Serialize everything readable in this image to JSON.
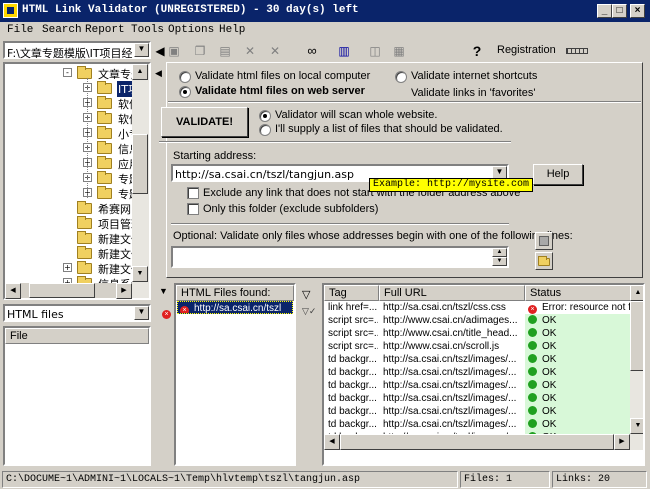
{
  "title": "HTML Link Validator (UNREGISTERED) - 30 day(s) left",
  "menu": [
    "File",
    "Search",
    "Report",
    "Tools",
    "Options",
    "Help"
  ],
  "toolbar": {
    "registration": "Registration",
    "help_icon": "?"
  },
  "path_combo": "F:\\文章专题模版\\IT项目经",
  "tree": [
    {
      "label": "文章专题",
      "pm": "-",
      "indent": 0
    },
    {
      "label": "IT项",
      "pm": "+",
      "indent": 1,
      "selected": true
    },
    {
      "label": "软件",
      "pm": "+",
      "indent": 1
    },
    {
      "label": "软件",
      "pm": "+",
      "indent": 1
    },
    {
      "label": "小专",
      "pm": "+",
      "indent": 1
    },
    {
      "label": "信息",
      "pm": "+",
      "indent": 1
    },
    {
      "label": "应用",
      "pm": "+",
      "indent": 1
    },
    {
      "label": "专题",
      "pm": "+",
      "indent": 1
    },
    {
      "label": "专题",
      "pm": "+",
      "indent": 1
    },
    {
      "label": "希赛网",
      "pm": "",
      "indent": -1
    },
    {
      "label": "项目管理",
      "pm": "",
      "indent": -1
    },
    {
      "label": "新建文件",
      "pm": "",
      "indent": -1
    },
    {
      "label": "新建文件",
      "pm": "",
      "indent": -1
    },
    {
      "label": "新建文件",
      "pm": "+",
      "indent": -1
    },
    {
      "label": "信息系统",
      "pm": "+",
      "indent": -1
    }
  ],
  "filter_combo": "HTML files",
  "file_list_header": "File",
  "options": {
    "radio_local": "Validate html files on local computer",
    "radio_web": "Validate html files on web server",
    "radio_shortcuts": "Validate internet shortcuts",
    "favorites_text": "Validate links in 'favorites'",
    "validate_button": "VALIDATE!",
    "radio_scan": "Validator will scan whole website.",
    "radio_list": "I'll supply a list of files that should be validated.",
    "starting_address_label": "Starting address:",
    "starting_address_value": "http://sa.csai.cn/tszl/tangjun.asp",
    "tooltip": "Example: http://mysite.com",
    "help_button": "Help",
    "chk_exclude": "Exclude any link that does not start with the folder address above",
    "chk_folder": "Only this folder (exclude subfolders)",
    "optional_label": "Optional: Validate only files whose addresses begin with one of the following lines:"
  },
  "html_files": {
    "header": "HTML Files found:",
    "items": [
      "http://sa.csai.cn/tszl"
    ]
  },
  "links_table": {
    "headers": [
      "Tag",
      "Full URL",
      "Status"
    ],
    "rows": [
      {
        "tag": "link href=...",
        "url": "http://sa.csai.cn/tszl/css.css",
        "status": "Error: resource not fo",
        "ok": false
      },
      {
        "tag": "script src=...",
        "url": "http://www.csai.cn/adimages...",
        "status": "OK",
        "ok": true
      },
      {
        "tag": "script src=...",
        "url": "http://www.csai.cn/title_head...",
        "status": "OK",
        "ok": true
      },
      {
        "tag": "script src=...",
        "url": "http://www.csai.cn/scroll.js",
        "status": "OK",
        "ok": true
      },
      {
        "tag": "td backgr...",
        "url": "http://sa.csai.cn/tszl/images/...",
        "status": "OK",
        "ok": true
      },
      {
        "tag": "td backgr...",
        "url": "http://sa.csai.cn/tszl/images/...",
        "status": "OK",
        "ok": true
      },
      {
        "tag": "td backgr...",
        "url": "http://sa.csai.cn/tszl/images/...",
        "status": "OK",
        "ok": true
      },
      {
        "tag": "td backgr...",
        "url": "http://sa.csai.cn/tszl/images/...",
        "status": "OK",
        "ok": true
      },
      {
        "tag": "td backgr...",
        "url": "http://sa.csai.cn/tszl/images/...",
        "status": "OK",
        "ok": true
      },
      {
        "tag": "td backgr...",
        "url": "http://sa.csai.cn/tszl/images/...",
        "status": "OK",
        "ok": true
      },
      {
        "tag": "td backgr...",
        "url": "http://sa.csai.cn/tszl/images/...",
        "status": "OK",
        "ok": true
      }
    ]
  },
  "statusbar": {
    "path": "C:\\DOCUME~1\\ADMINI~1\\LOCALS~1\\Temp\\hlvtemp\\tszl\\tangjun.asp",
    "files": "Files: 1",
    "links": "Links: 20"
  },
  "colors": {
    "title_bar": "#0a246a",
    "selection": "#0a246a",
    "ok_bg": "#d8f8d8",
    "tooltip_bg": "#ffff00",
    "ok_icon": "#20a020",
    "error_icon": "#e02020"
  }
}
